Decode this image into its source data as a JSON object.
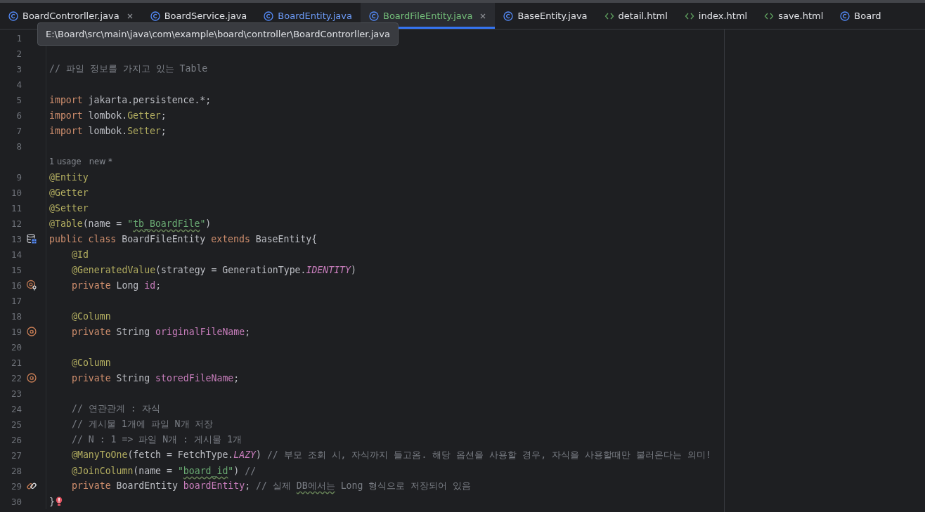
{
  "tabs": [
    {
      "label": "BoardControrller.java",
      "kind": "class",
      "color": "#dfe1e5",
      "selected": false,
      "closable": true
    },
    {
      "label": "BoardService.java",
      "kind": "class",
      "color": "#dfe1e5",
      "selected": false,
      "closable": false
    },
    {
      "label": "BoardEntity.java",
      "kind": "class",
      "color": "#6c9bf7",
      "selected": false,
      "closable": false
    },
    {
      "label": "BoardFileEntity.java",
      "kind": "class",
      "color": "#73bd79",
      "selected": true,
      "closable": true
    },
    {
      "label": "BaseEntity.java",
      "kind": "class",
      "color": "#dfe1e5",
      "selected": false,
      "closable": false
    },
    {
      "label": "detail.html",
      "kind": "html",
      "color": "#dfe1e5",
      "selected": false,
      "closable": false
    },
    {
      "label": "index.html",
      "kind": "html",
      "color": "#dfe1e5",
      "selected": false,
      "closable": false
    },
    {
      "label": "save.html",
      "kind": "html",
      "color": "#dfe1e5",
      "selected": false,
      "closable": false
    },
    {
      "label": "Board",
      "kind": "class",
      "color": "#dfe1e5",
      "selected": false,
      "closable": false
    }
  ],
  "tooltip": "E:\\Board\\src\\main\\java\\com\\example\\board\\controller\\BoardControrller.java",
  "lines": [
    {
      "kind": "code",
      "number": "1"
    },
    {
      "kind": "code",
      "number": "2"
    },
    {
      "kind": "code",
      "number": "3",
      "indented": false,
      "tokens": [
        {
          "kind": "comment",
          "text": "// 파일 정보를 가지고 있는 Table"
        }
      ]
    },
    {
      "kind": "code",
      "number": "4"
    },
    {
      "kind": "code",
      "number": "5",
      "indented": false,
      "tokens": [
        {
          "kind": "keyword",
          "text": "import "
        },
        {
          "kind": "plain",
          "text": "jakarta.persistence.*;"
        }
      ]
    },
    {
      "kind": "code",
      "number": "6",
      "indented": false,
      "tokens": [
        {
          "kind": "keyword",
          "text": "import "
        },
        {
          "kind": "plain",
          "text": "lombok."
        },
        {
          "kind": "annotation",
          "text": "Getter"
        },
        {
          "kind": "plain",
          "text": ";"
        }
      ]
    },
    {
      "kind": "code",
      "number": "7",
      "indented": false,
      "tokens": [
        {
          "kind": "keyword",
          "text": "import "
        },
        {
          "kind": "plain",
          "text": "lombok."
        },
        {
          "kind": "annotation",
          "text": "Setter"
        },
        {
          "kind": "plain",
          "text": ";"
        }
      ]
    },
    {
      "kind": "code",
      "number": "8"
    },
    {
      "kind": "inlay",
      "usage": "1 usage",
      "status": "new *"
    },
    {
      "kind": "code",
      "number": "9",
      "indented": false,
      "tokens": [
        {
          "kind": "annotation",
          "text": "@Entity"
        }
      ]
    },
    {
      "kind": "code",
      "number": "10",
      "indented": false,
      "tokens": [
        {
          "kind": "annotation",
          "text": "@Getter"
        }
      ]
    },
    {
      "kind": "code",
      "number": "11",
      "indented": false,
      "tokens": [
        {
          "kind": "annotation",
          "text": "@Setter"
        }
      ]
    },
    {
      "kind": "code",
      "number": "12",
      "indented": false,
      "tokens": [
        {
          "kind": "annotation",
          "text": "@Table"
        },
        {
          "kind": "plain",
          "text": "(name = "
        },
        {
          "kind": "string",
          "text": "\""
        },
        {
          "kind": "string",
          "text": "tb_BoardFile",
          "typo": true
        },
        {
          "kind": "string",
          "text": "\""
        },
        {
          "kind": "plain",
          "text": ")"
        }
      ]
    },
    {
      "kind": "code",
      "number": "13",
      "gutter": {
        "kind": "database"
      },
      "indented": false,
      "tokens": [
        {
          "kind": "keyword",
          "text": "public class "
        },
        {
          "kind": "plain",
          "text": "BoardFileEntity "
        },
        {
          "kind": "keyword",
          "text": "extends "
        },
        {
          "kind": "plain",
          "text": "BaseEntity{"
        }
      ]
    },
    {
      "kind": "code",
      "number": "14",
      "indented": true,
      "tokens": [
        {
          "kind": "annotation",
          "text": "@Id"
        }
      ]
    },
    {
      "kind": "code",
      "number": "15",
      "indented": true,
      "tokens": [
        {
          "kind": "annotation",
          "text": "@GeneratedValue"
        },
        {
          "kind": "plain",
          "text": "(strategy = GenerationType."
        },
        {
          "kind": "constant",
          "text": "IDENTITY"
        },
        {
          "kind": "plain",
          "text": ")"
        }
      ]
    },
    {
      "kind": "code",
      "number": "16",
      "gutter": {
        "kind": "key"
      },
      "indented": true,
      "tokens": [
        {
          "kind": "keyword",
          "text": "private "
        },
        {
          "kind": "plain",
          "text": "Long "
        },
        {
          "kind": "field",
          "text": "id"
        },
        {
          "kind": "plain",
          "text": ";"
        }
      ]
    },
    {
      "kind": "code",
      "number": "17"
    },
    {
      "kind": "code",
      "number": "18",
      "indented": true,
      "tokens": [
        {
          "kind": "annotation",
          "text": "@Column"
        }
      ]
    },
    {
      "kind": "code",
      "number": "19",
      "gutter": {
        "kind": "column"
      },
      "indented": true,
      "tokens": [
        {
          "kind": "keyword",
          "text": "private "
        },
        {
          "kind": "plain",
          "text": "String "
        },
        {
          "kind": "field",
          "text": "originalFileName"
        },
        {
          "kind": "plain",
          "text": ";"
        }
      ]
    },
    {
      "kind": "code",
      "number": "20"
    },
    {
      "kind": "code",
      "number": "21",
      "indented": true,
      "tokens": [
        {
          "kind": "annotation",
          "text": "@Column"
        }
      ]
    },
    {
      "kind": "code",
      "number": "22",
      "gutter": {
        "kind": "column"
      },
      "indented": true,
      "tokens": [
        {
          "kind": "keyword",
          "text": "private "
        },
        {
          "kind": "plain",
          "text": "String "
        },
        {
          "kind": "field",
          "text": "storedFileName"
        },
        {
          "kind": "plain",
          "text": ";"
        }
      ]
    },
    {
      "kind": "code",
      "number": "23"
    },
    {
      "kind": "code",
      "number": "24",
      "indented": true,
      "tokens": [
        {
          "kind": "comment",
          "text": "// 연관관계 : 자식"
        }
      ]
    },
    {
      "kind": "code",
      "number": "25",
      "indented": true,
      "tokens": [
        {
          "kind": "comment",
          "text": "// 게시물 1개에 파일 N개 저장"
        }
      ]
    },
    {
      "kind": "code",
      "number": "26",
      "indented": true,
      "tokens": [
        {
          "kind": "comment",
          "text": "// N : 1 => 파일 N개 : 게시물 1개"
        }
      ]
    },
    {
      "kind": "code",
      "number": "27",
      "indented": true,
      "tokens": [
        {
          "kind": "annotation",
          "text": "@ManyToOne"
        },
        {
          "kind": "plain",
          "text": "(fetch = FetchType."
        },
        {
          "kind": "constant",
          "text": "LAZY"
        },
        {
          "kind": "plain",
          "text": ") "
        },
        {
          "kind": "comment",
          "text": "// 부모 조회 시, 자식까지 들고옴. 해당 옵션을 사용할 경우, 자식을 사용할때만 불러온다는 의미!"
        }
      ]
    },
    {
      "kind": "code",
      "number": "28",
      "indented": true,
      "tokens": [
        {
          "kind": "annotation",
          "text": "@JoinColumn"
        },
        {
          "kind": "plain",
          "text": "(name = "
        },
        {
          "kind": "string",
          "text": "\""
        },
        {
          "kind": "string",
          "text": "board_id",
          "typo": true
        },
        {
          "kind": "string",
          "text": "\""
        },
        {
          "kind": "plain",
          "text": ") "
        },
        {
          "kind": "comment",
          "text": "//"
        }
      ]
    },
    {
      "kind": "code",
      "number": "29",
      "gutter": {
        "kind": "relation"
      },
      "indented": true,
      "tokens": [
        {
          "kind": "keyword",
          "text": "private "
        },
        {
          "kind": "plain",
          "text": "BoardEntity "
        },
        {
          "kind": "field",
          "text": "boardEntity"
        },
        {
          "kind": "plain",
          "text": "; "
        },
        {
          "kind": "comment",
          "text": "// 실제 "
        },
        {
          "kind": "comment",
          "text": "DB에서는",
          "typo": true
        },
        {
          "kind": "comment",
          "text": " Long 형식으로 저장되어 있음"
        }
      ]
    },
    {
      "kind": "code",
      "number": "30",
      "error": true,
      "indented": false,
      "tokens": [
        {
          "kind": "plain",
          "text": "}"
        }
      ]
    }
  ]
}
